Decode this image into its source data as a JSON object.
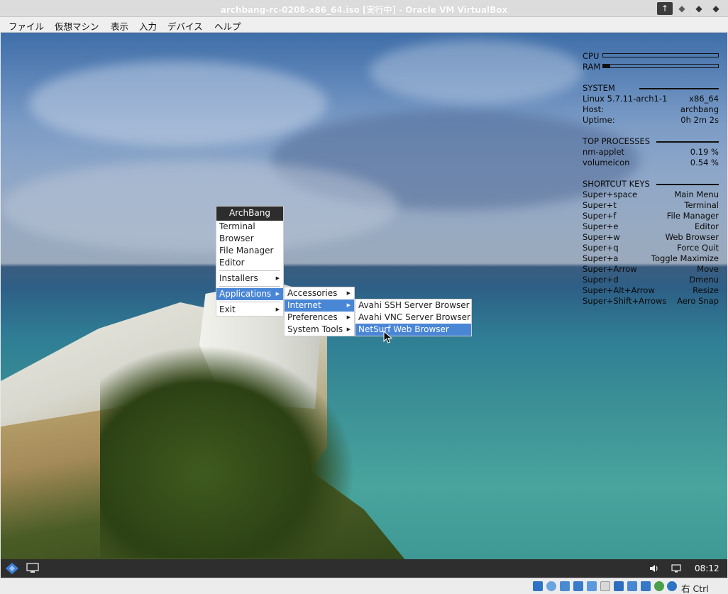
{
  "window": {
    "title": "archbang-rc-0208-x86_64.iso [実行中] - Oracle VM VirtualBox"
  },
  "menubar": {
    "items": [
      "ファイル",
      "仮想マシン",
      "表示",
      "入力",
      "デバイス",
      "ヘルプ"
    ]
  },
  "conky": {
    "cpu_label": "CPU",
    "cpu_fraction": 0.0,
    "ram_label": "RAM",
    "ram_fraction": 0.06,
    "system": {
      "heading": "SYSTEM",
      "kernel": "Linux 5.7.11-arch1-1",
      "arch": "x86_64",
      "host_label": "Host:",
      "host_value": "archbang",
      "uptime_label": "Uptime:",
      "uptime_value": "0h 2m 2s"
    },
    "processes": {
      "heading": "TOP PROCESSES",
      "rows": [
        {
          "name": "nm-applet",
          "value": "0.19 %"
        },
        {
          "name": "volumeicon",
          "value": "0.54 %"
        }
      ]
    },
    "shortcuts": {
      "heading": "SHORTCUT KEYS",
      "rows": [
        {
          "key": "Super+space",
          "action": "Main Menu"
        },
        {
          "key": "Super+t",
          "action": "Terminal"
        },
        {
          "key": "Super+f",
          "action": "File Manager"
        },
        {
          "key": "Super+e",
          "action": "Editor"
        },
        {
          "key": "Super+w",
          "action": "Web Browser"
        },
        {
          "key": "Super+q",
          "action": "Force Quit"
        },
        {
          "key": "Super+a",
          "action": "Toggle Maximize"
        },
        {
          "key": "Super+Arrow",
          "action": "Move"
        },
        {
          "key": "Super+d",
          "action": "Dmenu"
        },
        {
          "key": "Super+Alt+Arrow",
          "action": "Resize"
        },
        {
          "key": "Super+Shift+Arrows",
          "action": "Aero Snap"
        }
      ]
    }
  },
  "main_menu": {
    "title": "ArchBang",
    "items": {
      "terminal": "Terminal",
      "browser": "Browser",
      "file_manager": "File Manager",
      "editor": "Editor",
      "installers": "Installers",
      "applications": "Applications",
      "exit": "Exit"
    }
  },
  "apps_menu": {
    "items": [
      "Accessories",
      "Internet",
      "Preferences",
      "System Tools"
    ]
  },
  "internet_menu": {
    "items": [
      "Avahi SSH Server Browser",
      "Avahi VNC Server Browser",
      "NetSurf Web Browser"
    ]
  },
  "taskbar": {
    "clock": "08:12"
  },
  "statusbar": {
    "host_key": "右 Ctrl"
  },
  "colors": {
    "menu_highlight": "#4a86d6",
    "menu_title_bg": "#2d2d2d",
    "taskbar_bg": "#2e2e2e"
  }
}
